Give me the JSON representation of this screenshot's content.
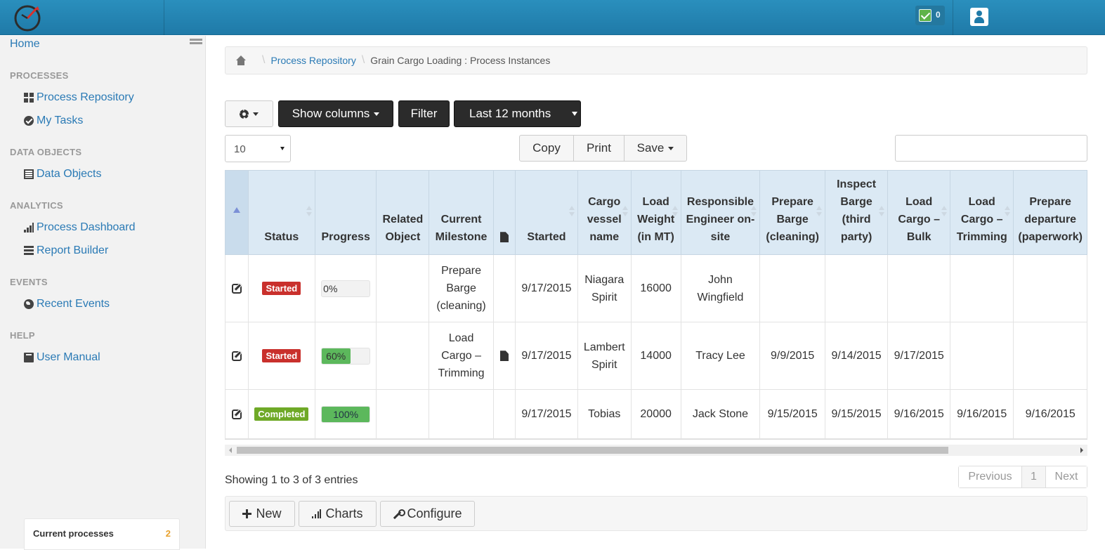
{
  "header": {
    "notification_count": "0"
  },
  "sidebar": {
    "home": "Home",
    "sections": [
      {
        "title": "PROCESSES",
        "items": [
          {
            "label": "Process Repository",
            "icon": "grid-icon"
          },
          {
            "label": "My Tasks",
            "icon": "check-circle-icon"
          }
        ]
      },
      {
        "title": "DATA OBJECTS",
        "items": [
          {
            "label": "Data Objects",
            "icon": "list-icon"
          }
        ]
      },
      {
        "title": "ANALYTICS",
        "items": [
          {
            "label": "Process Dashboard",
            "icon": "bar-chart-icon"
          },
          {
            "label": "Report Builder",
            "icon": "stack-icon"
          }
        ]
      },
      {
        "title": "EVENTS",
        "items": [
          {
            "label": "Recent Events",
            "icon": "globe-icon"
          }
        ]
      },
      {
        "title": "HELP",
        "items": [
          {
            "label": "User Manual",
            "icon": "book-icon"
          }
        ]
      }
    ],
    "current_processes": {
      "label": "Current processes",
      "count": "2"
    }
  },
  "breadcrumb": {
    "link": "Process Repository",
    "current": "Grain Cargo Loading : Process Instances"
  },
  "toolbar": {
    "show_columns": "Show columns",
    "filter": "Filter",
    "range": "Last 12 months"
  },
  "length_select": {
    "value": "10"
  },
  "export": {
    "copy": "Copy",
    "print": "Print",
    "save": "Save"
  },
  "table": {
    "columns": [
      "",
      "Status",
      "Progress",
      "Related Object",
      "Current Milestone",
      "",
      "Started",
      "Cargo vessel name",
      "Load Weight (in MT)",
      "Responsible Engineer on-site",
      "Prepare Barge (cleaning)",
      "Inspect Barge (third party)",
      "Load Cargo – Bulk",
      "Load Cargo – Trimming",
      "Prepare departure (paperwork)"
    ],
    "rows": [
      {
        "status": "Started",
        "status_color": "#c9302c",
        "progress": "0%",
        "progress_value": 0,
        "related": "",
        "milestone": "Prepare Barge (cleaning)",
        "doc": false,
        "started": "9/17/2015",
        "vessel": "Niagara Spirit",
        "weight": "16000",
        "engineer": "John Wingfield",
        "prepare": "",
        "inspect": "",
        "bulk": "",
        "trimming": "",
        "departure": ""
      },
      {
        "status": "Started",
        "status_color": "#c9302c",
        "progress": "60%",
        "progress_value": 60,
        "related": "",
        "milestone": "Load Cargo – Trimming",
        "doc": true,
        "started": "9/17/2015",
        "vessel": "Lambert Spirit",
        "weight": "14000",
        "engineer": "Tracy Lee",
        "prepare": "9/9/2015",
        "inspect": "9/14/2015",
        "bulk": "9/17/2015",
        "trimming": "",
        "departure": ""
      },
      {
        "status": "Completed",
        "status_color": "#6fa927",
        "progress": "100%",
        "progress_value": 100,
        "related": "",
        "milestone": "",
        "doc": false,
        "started": "9/17/2015",
        "vessel": "Tobias",
        "weight": "20000",
        "engineer": "Jack Stone",
        "prepare": "9/15/2015",
        "inspect": "9/15/2015",
        "bulk": "9/16/2015",
        "trimming": "9/16/2015",
        "departure": "9/16/2015"
      }
    ]
  },
  "info": "Showing 1 to 3 of 3 entries",
  "pager": {
    "previous": "Previous",
    "page": "1",
    "next": "Next"
  },
  "footer": {
    "new": "New",
    "charts": "Charts",
    "configure": "Configure"
  }
}
